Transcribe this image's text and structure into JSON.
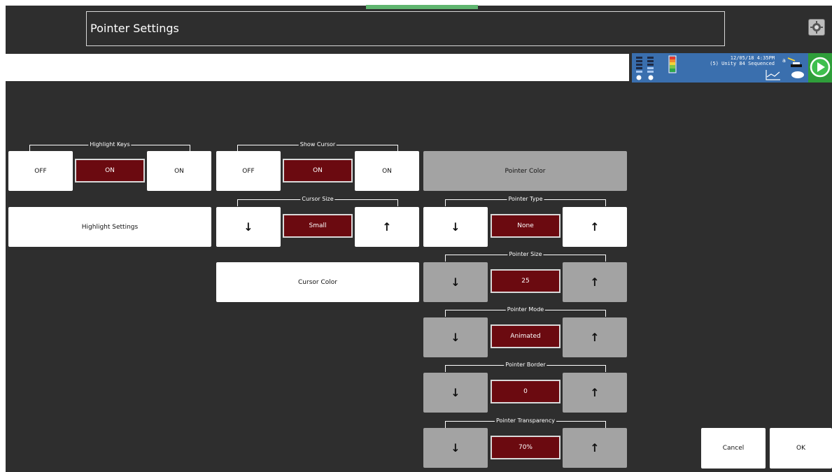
{
  "header": {
    "title": "Pointer Settings"
  },
  "status": {
    "datetime": "12/05/18 4:35PM",
    "device": "(5) Unity 84 Sequenced",
    "colors": {
      "status_panel": "#3a6fae",
      "play": "#2f9e3a",
      "accent": "#5fb56f"
    }
  },
  "highlight_keys": {
    "label": "Highlight Keys",
    "off": "OFF",
    "value": "ON",
    "on": "ON"
  },
  "highlight_settings": {
    "label": "Highlight Settings"
  },
  "show_cursor": {
    "label": "Show Cursor",
    "off": "OFF",
    "value": "ON",
    "on": "ON"
  },
  "cursor_size": {
    "label": "Cursor Size",
    "value": "Small"
  },
  "cursor_color": {
    "label": "Cursor Color"
  },
  "pointer_color": {
    "label": "Pointer Color"
  },
  "pointer_type": {
    "label": "Pointer Type",
    "value": "None"
  },
  "pointer_size": {
    "label": "Pointer Size",
    "value": "25"
  },
  "pointer_mode": {
    "label": "Pointer Mode",
    "value": "Animated"
  },
  "pointer_border": {
    "label": "Pointer Border",
    "value": "0"
  },
  "pointer_transparency": {
    "label": "Pointer Transparency",
    "value": "70%"
  },
  "arrows": {
    "down": "↓",
    "up": "↑"
  },
  "footer": {
    "cancel": "Cancel",
    "ok": "OK"
  },
  "icons": [
    "settings-menu-icon",
    "volume-level-icon",
    "battery-icon",
    "chart-icon",
    "speech-icon",
    "play-icon"
  ]
}
